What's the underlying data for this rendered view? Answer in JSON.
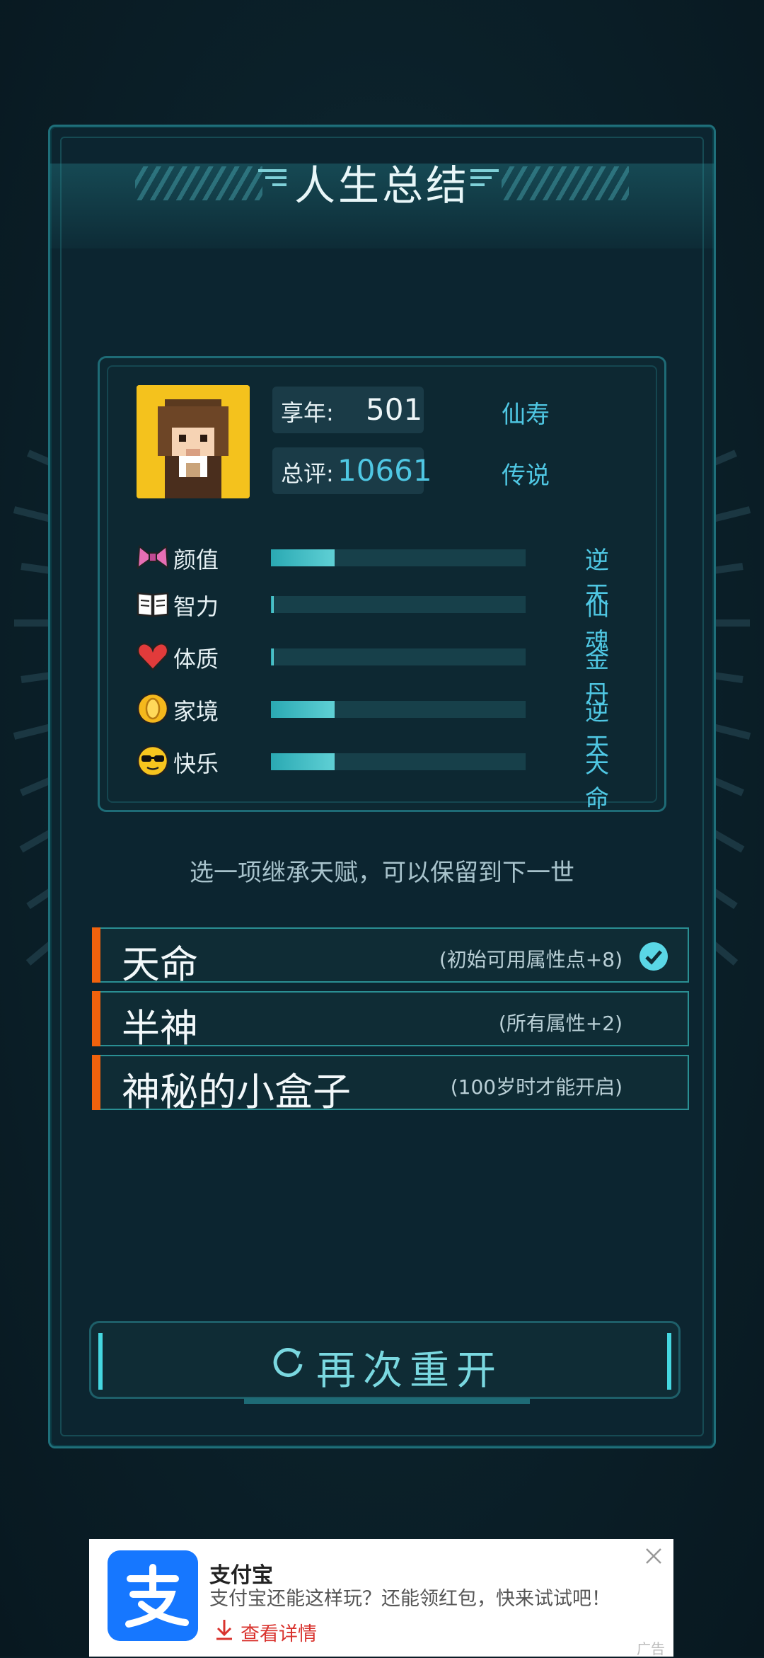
{
  "header": {
    "title": "人生总结"
  },
  "summary": {
    "age_label": "享年:",
    "age_value": "501",
    "age_grade": "仙寿",
    "score_label": "总评:",
    "score_value": "10661",
    "score_grade": "传说"
  },
  "stats": [
    {
      "name": "颜值",
      "grade": "逆天",
      "level": 0.25,
      "icon": "bow-icon"
    },
    {
      "name": "智力",
      "grade": "仙魂",
      "level": 0.0,
      "icon": "book-icon"
    },
    {
      "name": "体质",
      "grade": "金丹",
      "level": 0.0,
      "icon": "heart-icon"
    },
    {
      "name": "家境",
      "grade": "逆天",
      "level": 0.25,
      "icon": "coin-icon"
    },
    {
      "name": "快乐",
      "grade": "天命",
      "level": 0.25,
      "icon": "sunglasses-face-icon"
    }
  ],
  "hint": "选一项继承天赋，可以保留到下一世",
  "talents": [
    {
      "name": "天命",
      "desc": "(初始可用属性点+8)",
      "selected": true
    },
    {
      "name": "半神",
      "desc": "(所有属性+2)",
      "selected": false
    },
    {
      "name": "神秘的小盒子",
      "desc": "(100岁时才能开启)",
      "selected": false
    }
  ],
  "restart_label": "再次重开",
  "ad": {
    "title": "支付宝",
    "text": "支付宝还能这样玩？还能领红包，快来试试吧！",
    "link": "查看详情",
    "tag": "广告"
  },
  "colors": {
    "accent": "#4fc7e3",
    "talent_marker": "#f0620d",
    "bar_fill": "#2aa9b3"
  }
}
